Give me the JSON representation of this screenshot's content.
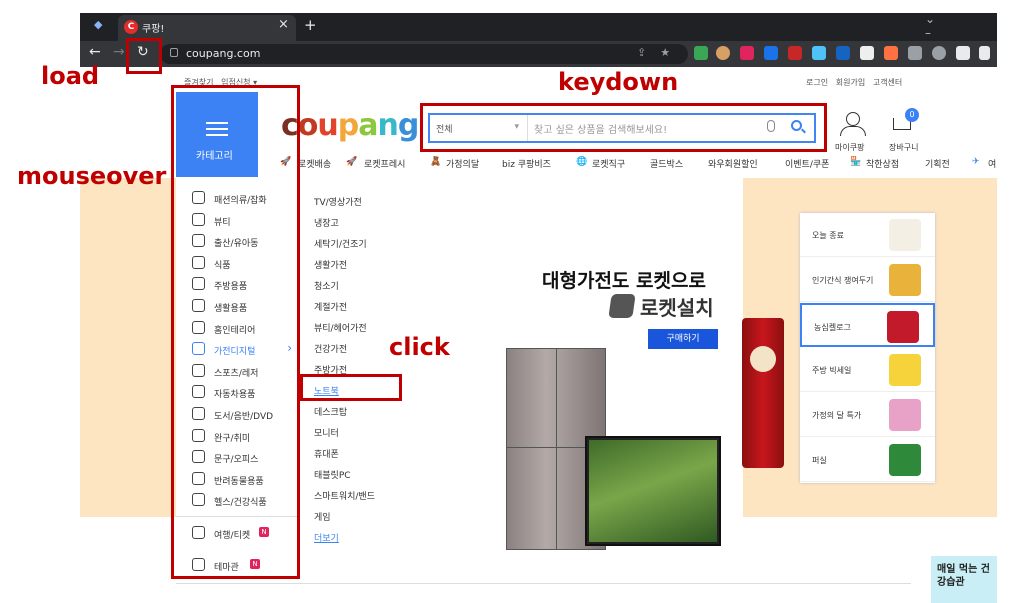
{
  "browser": {
    "tab_title": "쿠팡!",
    "tab_icon": "C",
    "url": "coupang.com",
    "close": "×",
    "new_tab": "+",
    "win_controls": "⌄ – ☐",
    "back": "←",
    "forward": "→",
    "reload": "↻"
  },
  "topnav": {
    "left": [
      "즐겨찾기",
      "입점신청 ▾"
    ],
    "right": [
      "로그인",
      "회원가입",
      "고객센터"
    ]
  },
  "category_button": {
    "label": "카테고리",
    "icon": "hamburger-icon"
  },
  "logo": {
    "parts": [
      {
        "t": "c",
        "c": "#7a2f20"
      },
      {
        "t": "o",
        "c": "#c03b21"
      },
      {
        "t": "u",
        "c": "#e2432b"
      },
      {
        "t": "p",
        "c": "#f3a73a"
      },
      {
        "t": "a",
        "c": "#8dc63f"
      },
      {
        "t": "n",
        "c": "#39b8c9"
      },
      {
        "t": "g",
        "c": "#3b8fd9"
      }
    ]
  },
  "search": {
    "category": "전체",
    "placeholder": "찾고 싶은 상품을 검색해보세요!",
    "mic": "microphone-icon",
    "btn": "search-icon"
  },
  "header_icons": [
    {
      "label": "마이쿠팡",
      "icon": "user-icon"
    },
    {
      "label": "장바구니",
      "icon": "cart-icon",
      "badge": "0"
    }
  ],
  "quicklinks": [
    "로켓배송",
    "로켓프레시",
    "가정의달",
    "biz 쿠팡비즈",
    "로켓직구",
    "골드박스",
    "와우회원할인",
    "이벤트/쿠폰",
    "착한상점",
    "기획전",
    "여"
  ],
  "menu1": {
    "items": [
      "패션의류/잡화",
      "뷰티",
      "출산/유아동",
      "식품",
      "주방용품",
      "생활용품",
      "홈인테리어",
      "가전디지털",
      "스포츠/레저",
      "자동차용품",
      "도서/음반/DVD",
      "완구/취미",
      "문구/오피스",
      "반려동물용품",
      "헬스/건강식품"
    ],
    "extra": [
      "여행/티켓",
      "테마관"
    ],
    "active": "가전디지털",
    "badge": "N"
  },
  "menu2": {
    "items": [
      "TV/영상가전",
      "냉장고",
      "세탁기/건조기",
      "생활가전",
      "청소기",
      "계절가전",
      "뷰티/헤어가전",
      "건강가전",
      "주방가전",
      "노트북",
      "데스크탑",
      "모니터",
      "휴대폰",
      "태블릿PC",
      "스마트워치/밴드",
      "게임"
    ],
    "more": "더보기"
  },
  "banner": {
    "headline": "대형가전도 로켓으로",
    "brand": "로켓설치",
    "button": "구매하기"
  },
  "promo": [
    {
      "label": "오늘 종료"
    },
    {
      "label": "인기간식 쟁여두기"
    },
    {
      "label": "농심켈로그"
    },
    {
      "label": "주방 빅세일"
    },
    {
      "label": "가정의 달 특가"
    },
    {
      "label": "퍼실"
    }
  ],
  "corner_ad": {
    "text": "매일 먹는 건강습관"
  },
  "annotations": {
    "load": "load",
    "keydown": "keydown",
    "mouseover": "mouseover",
    "click": "click"
  },
  "colors": {
    "accent": "#3c82f5",
    "annotation": "#c00000",
    "hero_bg": "#fde5c2",
    "chrome_dark": "#202124"
  }
}
